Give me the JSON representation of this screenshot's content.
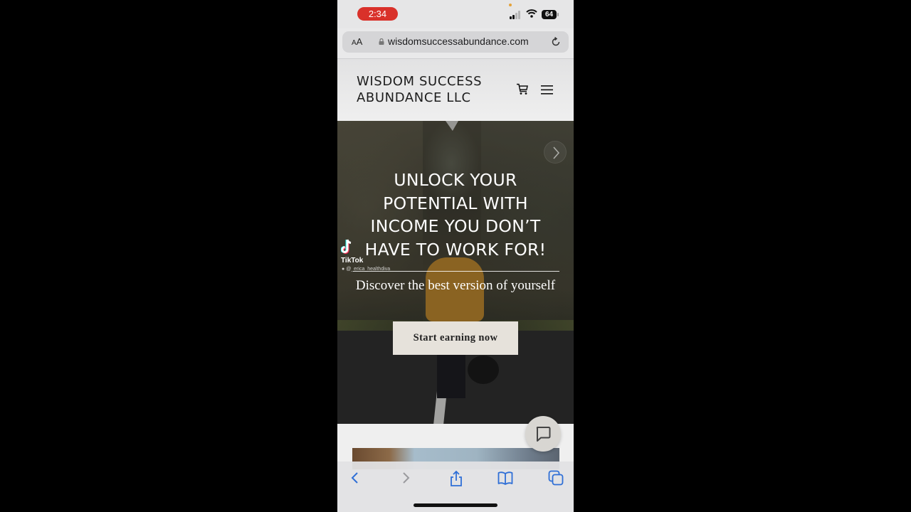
{
  "status_bar": {
    "time": "2:34",
    "battery": "64",
    "icons": [
      "signal-icon",
      "wifi-icon",
      "battery-icon"
    ]
  },
  "browser": {
    "text_size_label_small": "A",
    "text_size_label_large": "A",
    "url": "wisdomsuccessabundance.com",
    "icons": [
      "lock-icon",
      "reload-icon"
    ]
  },
  "site_header": {
    "title_line1": "WISDOM SUCCESS",
    "title_line2": "ABUNDANCE LLC",
    "icons": [
      "cart-icon",
      "menu-icon"
    ]
  },
  "hero": {
    "title_lines": [
      "UNLOCK YOUR",
      "POTENTIAL WITH",
      "INCOME YOU DON’T",
      "HAVE TO WORK FOR!"
    ],
    "subtitle": "Discover the best version of yourself",
    "cta_label": "Start earning now",
    "next_icon": "chevron-right-icon"
  },
  "watermark": {
    "brand": "TikTok",
    "user": "@_erica_healthdiva"
  },
  "chat": {
    "icon": "chat-bubble-icon"
  },
  "toolbar": {
    "icons": [
      "back-icon",
      "forward-icon",
      "share-icon",
      "bookmarks-icon",
      "tabs-icon"
    ],
    "accent": "#2f6fd6"
  },
  "colors": {
    "time_pill": "#d9312a",
    "cta_background": "#e6e2db",
    "toolbar_accent": "#2f6fd6"
  }
}
